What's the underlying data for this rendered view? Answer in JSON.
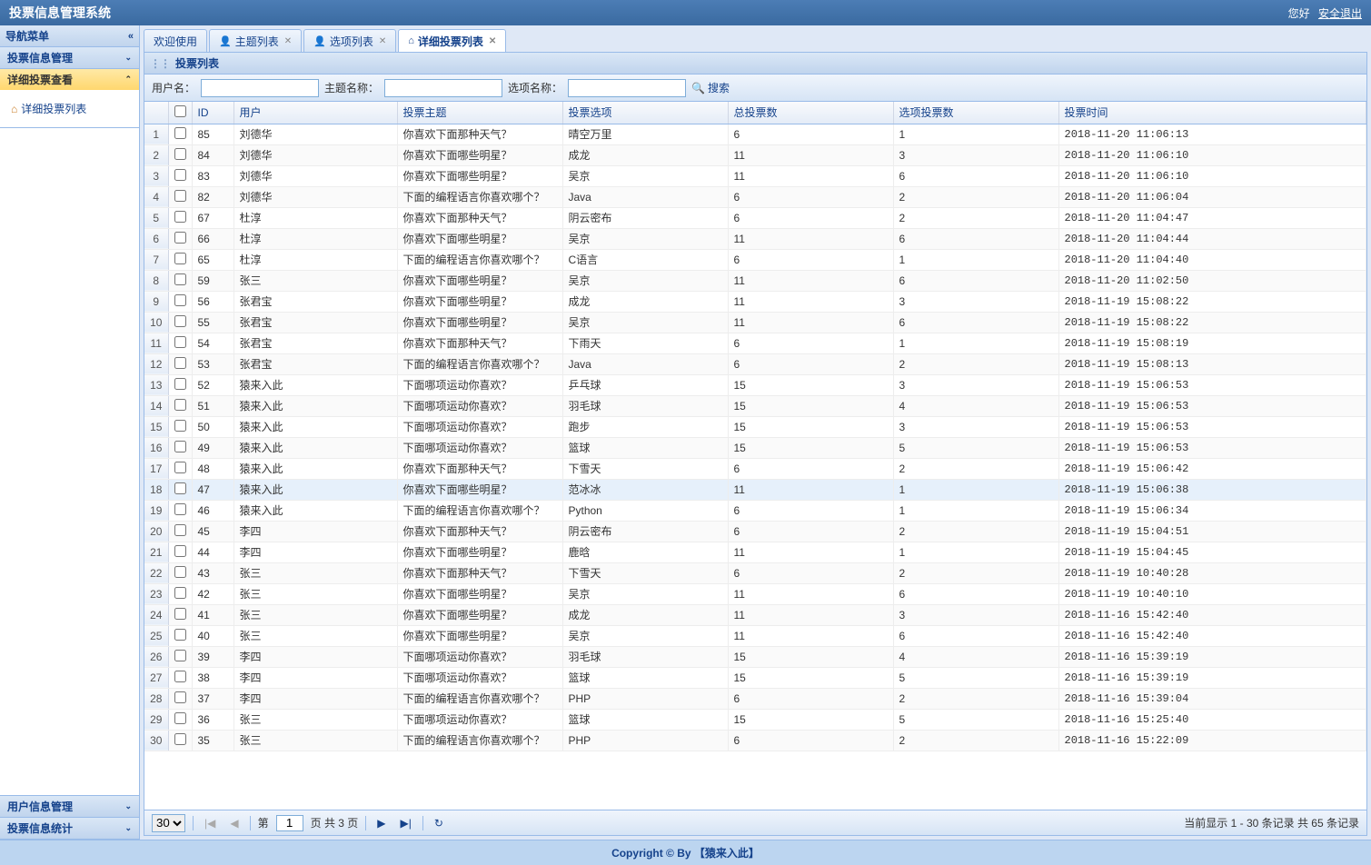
{
  "header": {
    "title": "投票信息管理系统",
    "greeting": "您好",
    "logout": "安全退出"
  },
  "sidebar": {
    "title": "导航菜单",
    "items": [
      {
        "label": "投票信息管理",
        "active": false
      },
      {
        "label": "详细投票查看",
        "active": true,
        "children": [
          {
            "label": "详细投票列表"
          }
        ]
      },
      {
        "label": "用户信息管理",
        "active": false
      },
      {
        "label": "投票信息统计",
        "active": false
      }
    ]
  },
  "tabs": [
    {
      "label": "欢迎使用",
      "icon": "home",
      "closable": false,
      "active": false
    },
    {
      "label": "主题列表",
      "icon": "user",
      "closable": true,
      "active": false
    },
    {
      "label": "选项列表",
      "icon": "user",
      "closable": true,
      "active": false
    },
    {
      "label": "详细投票列表",
      "icon": "house",
      "closable": true,
      "active": true
    }
  ],
  "panel_title": "投票列表",
  "search": {
    "user_label": "用户名：",
    "topic_label": "主题名称：",
    "option_label": "选项名称：",
    "button": "搜索"
  },
  "columns": [
    "ID",
    "用户",
    "投票主题",
    "投票选项",
    "总投票数",
    "选项投票数",
    "投票时间"
  ],
  "rows": [
    {
      "n": 1,
      "id": 85,
      "user": "刘德华",
      "topic": "你喜欢下面那种天气？",
      "option": "晴空万里",
      "total": 6,
      "ov": 1,
      "time": "2018-11-20 11:06:13"
    },
    {
      "n": 2,
      "id": 84,
      "user": "刘德华",
      "topic": "你喜欢下面哪些明星？",
      "option": "成龙",
      "total": 11,
      "ov": 3,
      "time": "2018-11-20 11:06:10"
    },
    {
      "n": 3,
      "id": 83,
      "user": "刘德华",
      "topic": "你喜欢下面哪些明星？",
      "option": "吴京",
      "total": 11,
      "ov": 6,
      "time": "2018-11-20 11:06:10"
    },
    {
      "n": 4,
      "id": 82,
      "user": "刘德华",
      "topic": "下面的编程语言你喜欢哪个？",
      "option": "Java",
      "total": 6,
      "ov": 2,
      "time": "2018-11-20 11:06:04"
    },
    {
      "n": 5,
      "id": 67,
      "user": "杜淳",
      "topic": "你喜欢下面那种天气？",
      "option": "阴云密布",
      "total": 6,
      "ov": 2,
      "time": "2018-11-20 11:04:47"
    },
    {
      "n": 6,
      "id": 66,
      "user": "杜淳",
      "topic": "你喜欢下面哪些明星？",
      "option": "吴京",
      "total": 11,
      "ov": 6,
      "time": "2018-11-20 11:04:44"
    },
    {
      "n": 7,
      "id": 65,
      "user": "杜淳",
      "topic": "下面的编程语言你喜欢哪个？",
      "option": "C语言",
      "total": 6,
      "ov": 1,
      "time": "2018-11-20 11:04:40"
    },
    {
      "n": 8,
      "id": 59,
      "user": "张三",
      "topic": "你喜欢下面哪些明星？",
      "option": "吴京",
      "total": 11,
      "ov": 6,
      "time": "2018-11-20 11:02:50"
    },
    {
      "n": 9,
      "id": 56,
      "user": "张君宝",
      "topic": "你喜欢下面哪些明星？",
      "option": "成龙",
      "total": 11,
      "ov": 3,
      "time": "2018-11-19 15:08:22"
    },
    {
      "n": 10,
      "id": 55,
      "user": "张君宝",
      "topic": "你喜欢下面哪些明星？",
      "option": "吴京",
      "total": 11,
      "ov": 6,
      "time": "2018-11-19 15:08:22"
    },
    {
      "n": 11,
      "id": 54,
      "user": "张君宝",
      "topic": "你喜欢下面那种天气？",
      "option": "下雨天",
      "total": 6,
      "ov": 1,
      "time": "2018-11-19 15:08:19"
    },
    {
      "n": 12,
      "id": 53,
      "user": "张君宝",
      "topic": "下面的编程语言你喜欢哪个？",
      "option": "Java",
      "total": 6,
      "ov": 2,
      "time": "2018-11-19 15:08:13"
    },
    {
      "n": 13,
      "id": 52,
      "user": "猿来入此",
      "topic": "下面哪项运动你喜欢？",
      "option": "乒乓球",
      "total": 15,
      "ov": 3,
      "time": "2018-11-19 15:06:53"
    },
    {
      "n": 14,
      "id": 51,
      "user": "猿来入此",
      "topic": "下面哪项运动你喜欢？",
      "option": "羽毛球",
      "total": 15,
      "ov": 4,
      "time": "2018-11-19 15:06:53"
    },
    {
      "n": 15,
      "id": 50,
      "user": "猿来入此",
      "topic": "下面哪项运动你喜欢？",
      "option": "跑步",
      "total": 15,
      "ov": 3,
      "time": "2018-11-19 15:06:53"
    },
    {
      "n": 16,
      "id": 49,
      "user": "猿来入此",
      "topic": "下面哪项运动你喜欢？",
      "option": "篮球",
      "total": 15,
      "ov": 5,
      "time": "2018-11-19 15:06:53"
    },
    {
      "n": 17,
      "id": 48,
      "user": "猿来入此",
      "topic": "你喜欢下面那种天气？",
      "option": "下雪天",
      "total": 6,
      "ov": 2,
      "time": "2018-11-19 15:06:42"
    },
    {
      "n": 18,
      "id": 47,
      "user": "猿来入此",
      "topic": "你喜欢下面哪些明星？",
      "option": "范冰冰",
      "total": 11,
      "ov": 1,
      "time": "2018-11-19 15:06:38",
      "hover": true
    },
    {
      "n": 19,
      "id": 46,
      "user": "猿来入此",
      "topic": "下面的编程语言你喜欢哪个？",
      "option": "Python",
      "total": 6,
      "ov": 1,
      "time": "2018-11-19 15:06:34"
    },
    {
      "n": 20,
      "id": 45,
      "user": "李四",
      "topic": "你喜欢下面那种天气？",
      "option": "阴云密布",
      "total": 6,
      "ov": 2,
      "time": "2018-11-19 15:04:51"
    },
    {
      "n": 21,
      "id": 44,
      "user": "李四",
      "topic": "你喜欢下面哪些明星？",
      "option": "鹿晗",
      "total": 11,
      "ov": 1,
      "time": "2018-11-19 15:04:45"
    },
    {
      "n": 22,
      "id": 43,
      "user": "张三",
      "topic": "你喜欢下面那种天气？",
      "option": "下雪天",
      "total": 6,
      "ov": 2,
      "time": "2018-11-19 10:40:28"
    },
    {
      "n": 23,
      "id": 42,
      "user": "张三",
      "topic": "你喜欢下面哪些明星？",
      "option": "吴京",
      "total": 11,
      "ov": 6,
      "time": "2018-11-19 10:40:10"
    },
    {
      "n": 24,
      "id": 41,
      "user": "张三",
      "topic": "你喜欢下面哪些明星？",
      "option": "成龙",
      "total": 11,
      "ov": 3,
      "time": "2018-11-16 15:42:40"
    },
    {
      "n": 25,
      "id": 40,
      "user": "张三",
      "topic": "你喜欢下面哪些明星？",
      "option": "吴京",
      "total": 11,
      "ov": 6,
      "time": "2018-11-16 15:42:40"
    },
    {
      "n": 26,
      "id": 39,
      "user": "李四",
      "topic": "下面哪项运动你喜欢？",
      "option": "羽毛球",
      "total": 15,
      "ov": 4,
      "time": "2018-11-16 15:39:19"
    },
    {
      "n": 27,
      "id": 38,
      "user": "李四",
      "topic": "下面哪项运动你喜欢？",
      "option": "篮球",
      "total": 15,
      "ov": 5,
      "time": "2018-11-16 15:39:19"
    },
    {
      "n": 28,
      "id": 37,
      "user": "李四",
      "topic": "下面的编程语言你喜欢哪个？",
      "option": "PHP",
      "total": 6,
      "ov": 2,
      "time": "2018-11-16 15:39:04"
    },
    {
      "n": 29,
      "id": 36,
      "user": "张三",
      "topic": "下面哪项运动你喜欢？",
      "option": "篮球",
      "total": 15,
      "ov": 5,
      "time": "2018-11-16 15:25:40"
    },
    {
      "n": 30,
      "id": 35,
      "user": "张三",
      "topic": "下面的编程语言你喜欢哪个？",
      "option": "PHP",
      "total": 6,
      "ov": 2,
      "time": "2018-11-16 15:22:09"
    }
  ],
  "pager": {
    "page_size": "30",
    "page_label_prefix": "第",
    "page_current": "1",
    "page_label_suffix": "页 共 3 页",
    "display_text": "当前显示 1 - 30 条记录 共 65 条记录"
  },
  "footer": "Copyright © By 【猿来入此】"
}
